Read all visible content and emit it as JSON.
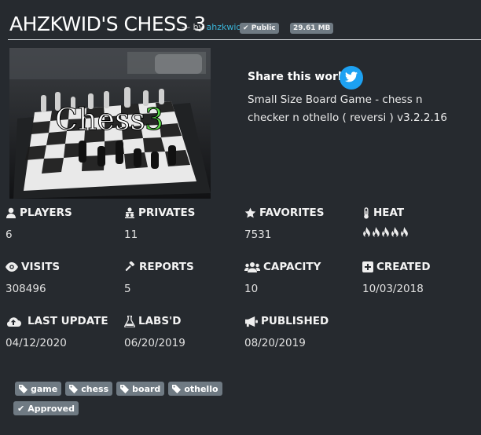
{
  "header": {
    "title": "AHZKWID'S CHESS 3",
    "by_prefix": "— by",
    "author": "ahzkwid",
    "badge_public": "Public",
    "badge_size": "29.61 MB"
  },
  "thumbnail": {
    "overlay_word": "Chess",
    "overlay_number": "3"
  },
  "share": {
    "title": "Share this world",
    "icon": "twitter-icon",
    "accent": "#1da1f2"
  },
  "description": "Small Size Board Game - chess n checker n othello ( reversi ) v3.2.2.16",
  "stats": {
    "players": {
      "label": "PLAYERS",
      "value": "6",
      "icon": "user-icon"
    },
    "privates": {
      "label": "PRIVATES",
      "value": "11",
      "icon": "users-hidden-icon"
    },
    "favorites": {
      "label": "FAVORITES",
      "value": "7531",
      "icon": "star-icon"
    },
    "heat": {
      "label": "HEAT",
      "value": 5,
      "icon": "thermometer-icon",
      "flame_icon": "flame-icon"
    },
    "visits": {
      "label": "VISITS",
      "value": "308496",
      "icon": "eye-icon"
    },
    "reports": {
      "label": "REPORTS",
      "value": "5",
      "icon": "gavel-icon"
    },
    "capacity": {
      "label": "CAPACITY",
      "value": "10",
      "icon": "users-icon"
    },
    "created": {
      "label": "CREATED",
      "value": "10/03/2018",
      "icon": "plus-square-icon"
    },
    "last_update": {
      "label": "LAST UPDATE",
      "value": "04/12/2020",
      "icon": "cloud-upload-icon"
    },
    "labsd": {
      "label": "LABS'D",
      "value": "06/20/2019",
      "icon": "flask-icon"
    },
    "published": {
      "label": "PUBLISHED",
      "value": "08/20/2019",
      "icon": "megaphone-icon"
    }
  },
  "tags": [
    "game",
    "chess",
    "board",
    "othello"
  ],
  "status_tag": "Approved",
  "colors": {
    "background": "#262a2f",
    "author_link": "#3ab3d6",
    "badge": "#6f7a83"
  }
}
